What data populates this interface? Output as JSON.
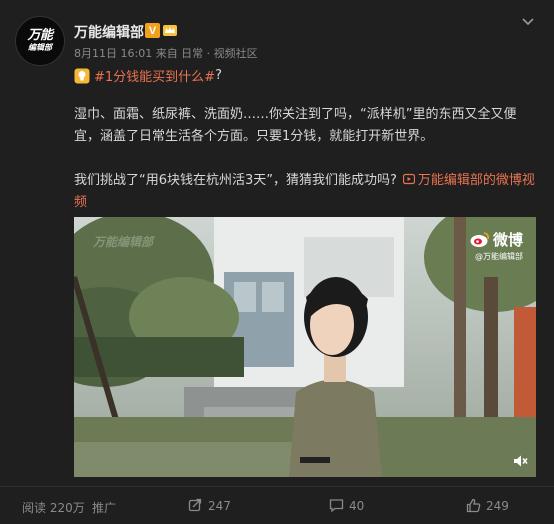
{
  "post": {
    "author": "万能编辑部",
    "avatar_line1": "万能",
    "avatar_line2": "编辑部",
    "vip_label": "V",
    "meta": "8月11日 16:01 来自 日常 · 视频社区",
    "topic": "#1分钱能买到什么#",
    "topic_suffix": "?",
    "paragraph1": "湿巾、面霜、纸尿裤、洗面奶……你关注到了吗，“派样机”里的东西又全又便宜，涵盖了日常生活各个方面。只要1分钱，就能打开新世界。",
    "paragraph2_text": "我们挑战了“用6块钱在杭州活3天”，猜猜我们能成功吗?",
    "video_link_label": "万能编辑部的微博视频"
  },
  "video": {
    "watermark_brand": "万能编辑部",
    "watermark_logo_text": "微博",
    "watermark_sub": "@万能编辑部"
  },
  "footer": {
    "reads": "阅读 220万",
    "promote": "推广",
    "reposts": "247",
    "comments": "40",
    "likes": "249"
  },
  "colors": {
    "accent": "#eb7350",
    "background": "#1f1f1f",
    "text": "#d8d8d8",
    "muted": "#8a8a8a",
    "vip": "#f3a01f"
  },
  "icons": [
    "crown-icon",
    "chevron-down-icon",
    "bulb-icon",
    "video-link-icon",
    "weibo-logo-icon",
    "mute-icon",
    "repost-icon",
    "comment-icon",
    "like-icon"
  ]
}
